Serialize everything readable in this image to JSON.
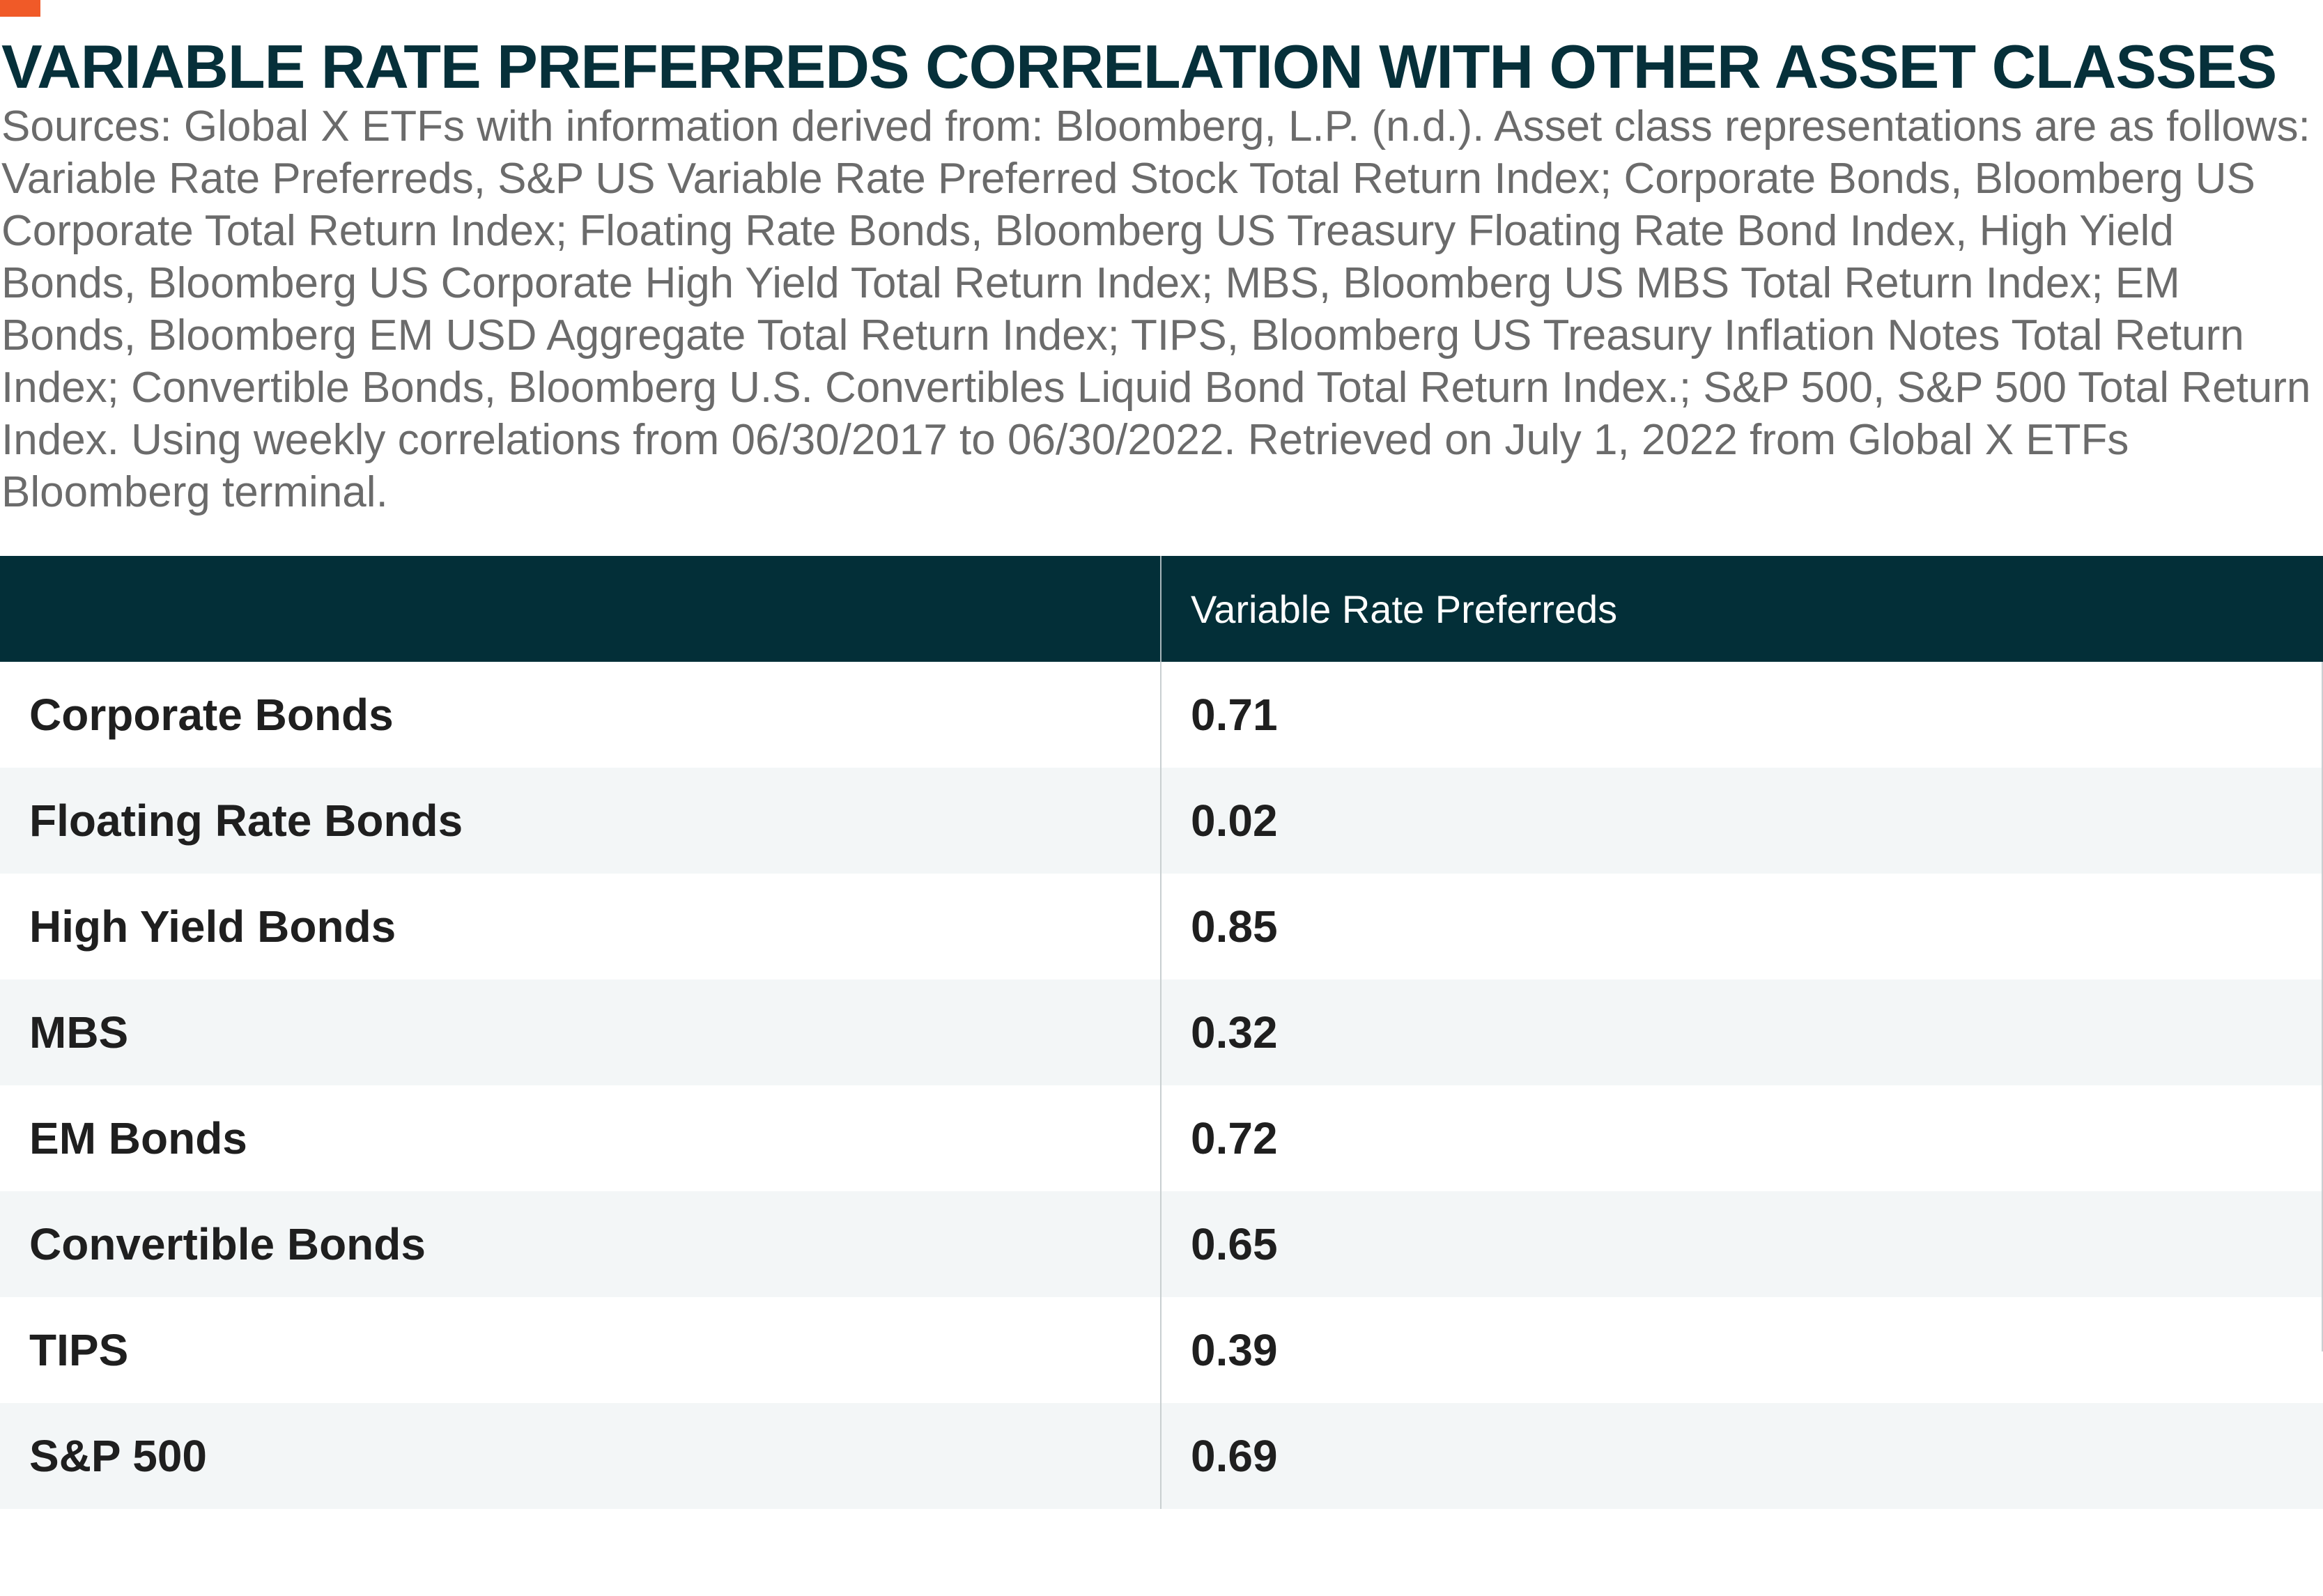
{
  "colors": {
    "accent": "#f05a28",
    "title": "#06303a",
    "header_bg": "#032f38",
    "stripe": "#f3f6f7",
    "source_text": "#6b6b6b"
  },
  "title": "VARIABLE RATE PREFERREDS CORRELATION WITH OTHER ASSET CLASSES",
  "sources": "Sources: Global X ETFs with information derived from: Bloomberg, L.P. (n.d.). Asset class representations are as follows: Variable Rate Preferreds, S&P US Variable Rate Preferred Stock Total Return Index; Corporate Bonds, Bloomberg US Corporate Total Return Index; Floating Rate Bonds, Bloomberg US Treasury Floating Rate Bond Index, High Yield Bonds, Bloomberg US Corporate High Yield Total Return Index; MBS, Bloomberg US MBS Total Return Index; EM Bonds, Bloomberg EM USD Aggregate Total Return Index; TIPS, Bloomberg US Treasury Inflation Notes Total Return Index; Convertible Bonds, Bloomberg U.S. Convertibles Liquid Bond Total Return Index.; S&P 500, S&P 500 Total Return Index. Using weekly correlations from 06/30/2017 to 06/30/2022. Retrieved on July 1, 2022 from Global X ETFs Bloomberg terminal.",
  "chart_data": {
    "type": "table",
    "title": "VARIABLE RATE PREFERREDS CORRELATION WITH OTHER ASSET CLASSES",
    "columns": [
      "",
      "Variable Rate Preferreds"
    ],
    "rows": [
      {
        "label": "Corporate Bonds",
        "value": "0.71"
      },
      {
        "label": "Floating Rate Bonds",
        "value": "0.02"
      },
      {
        "label": "High Yield Bonds",
        "value": "0.85"
      },
      {
        "label": "MBS",
        "value": "0.32"
      },
      {
        "label": "EM Bonds",
        "value": "0.72"
      },
      {
        "label": "Convertible Bonds",
        "value": "0.65"
      },
      {
        "label": "TIPS",
        "value": "0.39"
      },
      {
        "label": "S&P 500",
        "value": "0.69"
      }
    ]
  }
}
